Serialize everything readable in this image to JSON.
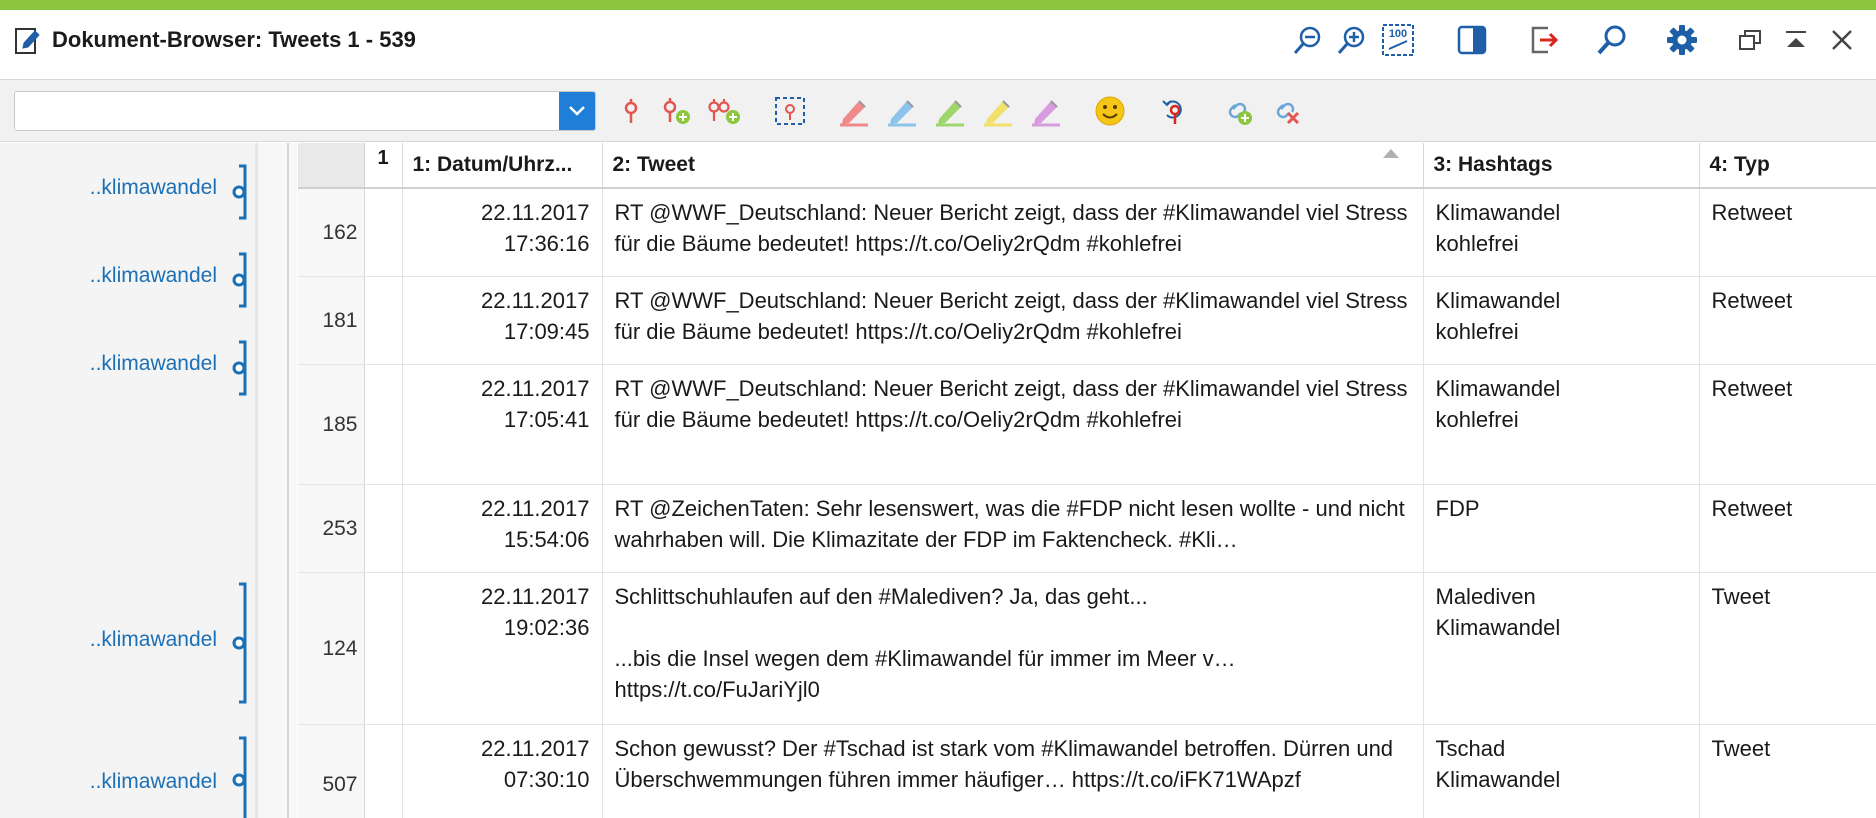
{
  "window": {
    "title": "Dokument-Browser: Tweets 1 - 539",
    "accent_color": "#8cc63f"
  },
  "title_buttons": [
    {
      "name": "zoom-out-icon"
    },
    {
      "name": "zoom-in-icon"
    },
    {
      "name": "zoom-100-icon",
      "label": "100"
    },
    {
      "name": "panel-toggle-icon"
    },
    {
      "name": "export-icon"
    },
    {
      "name": "search-icon"
    },
    {
      "name": "settings-gear-icon"
    },
    {
      "name": "restore-window-icon"
    },
    {
      "name": "collapse-icon"
    },
    {
      "name": "close-icon"
    }
  ],
  "toolbar": {
    "search_value": "",
    "combo_color": "#1f7fd8",
    "tools": [
      {
        "name": "code-icon"
      },
      {
        "name": "code-add-icon"
      },
      {
        "name": "code-add-multiple-icon"
      },
      {
        "name": "selection-frame-icon"
      },
      {
        "name": "highlighter-red-icon",
        "color": "#f08a8a"
      },
      {
        "name": "highlighter-blue-icon",
        "color": "#8cc3ea"
      },
      {
        "name": "highlighter-green-icon",
        "color": "#9fd66b"
      },
      {
        "name": "highlighter-yellow-icon",
        "color": "#f2e06c"
      },
      {
        "name": "highlighter-purple-icon",
        "color": "#d99be0"
      },
      {
        "name": "emoticon-icon"
      },
      {
        "name": "undo-code-icon"
      },
      {
        "name": "link-add-icon"
      },
      {
        "name": "link-remove-icon"
      }
    ]
  },
  "code_panel": {
    "color": "#1b6fb5",
    "marks": [
      {
        "label": "..klimawandel"
      },
      {
        "label": "..klimawandel"
      },
      {
        "label": "..klimawandel"
      },
      {
        "label": "..klimawandel"
      },
      {
        "label": "..klimawandel"
      }
    ]
  },
  "table": {
    "columns": {
      "flag": "1",
      "datum": "1: Datum/Uhrz...",
      "tweet": "2: Tweet",
      "hashtags": "3: Hashtags",
      "typ": "4: Typ"
    },
    "rows": [
      {
        "num": "162",
        "date": "22.11.2017",
        "time": "17:36:16",
        "tweet": "RT @WWF_Deutschland: Neuer Bericht zeigt, dass der #Klimawandel viel Stress für die Bäume bedeutet! https://t.co/Oeliy2rQdm #kohlefrei",
        "hashtags": "Klimawandel\nkohlefrei",
        "typ": "Retweet"
      },
      {
        "num": "181",
        "date": "22.11.2017",
        "time": "17:09:45",
        "tweet": "RT @WWF_Deutschland: Neuer Bericht zeigt, dass der #Klimawandel viel Stress für die Bäume bedeutet! https://t.co/Oeliy2rQdm #kohlefrei",
        "hashtags": "Klimawandel\nkohlefrei",
        "typ": "Retweet"
      },
      {
        "num": "185",
        "date": "22.11.2017",
        "time": "17:05:41",
        "tweet": "RT @WWF_Deutschland: Neuer Bericht zeigt, dass der #Klimawandel viel Stress für die Bäume bedeutet! https://t.co/Oeliy2rQdm #kohlefrei",
        "hashtags": "Klimawandel\nkohlefrei",
        "typ": "Retweet"
      },
      {
        "num": "253",
        "date": "22.11.2017",
        "time": "15:54:06",
        "tweet": "RT @ZeichenTaten: Sehr lesenswert, was die #FDP nicht lesen wollte - und nicht wahrhaben will. Die Klimazitate der FDP im Faktencheck. #Kli…",
        "hashtags": "FDP",
        "typ": "Retweet"
      },
      {
        "num": "124",
        "date": "22.11.2017",
        "time": "19:02:36",
        "tweet": "Schlittschuhlaufen auf den #Malediven? Ja, das geht...\n\n...bis die Insel wegen dem #Klimawandel für immer im Meer v… https://t.co/FuJariYjl0",
        "hashtags": "Malediven\nKlimawandel",
        "typ": "Tweet"
      },
      {
        "num": "507",
        "date": "22.11.2017",
        "time": "07:30:10",
        "tweet": "Schon gewusst? Der #Tschad ist stark vom #Klimawandel betroffen. Dürren und Überschwemmungen führen immer häufiger… https://t.co/iFK71WApzf",
        "hashtags": "Tschad\nKlimawandel",
        "typ": "Tweet"
      }
    ]
  }
}
